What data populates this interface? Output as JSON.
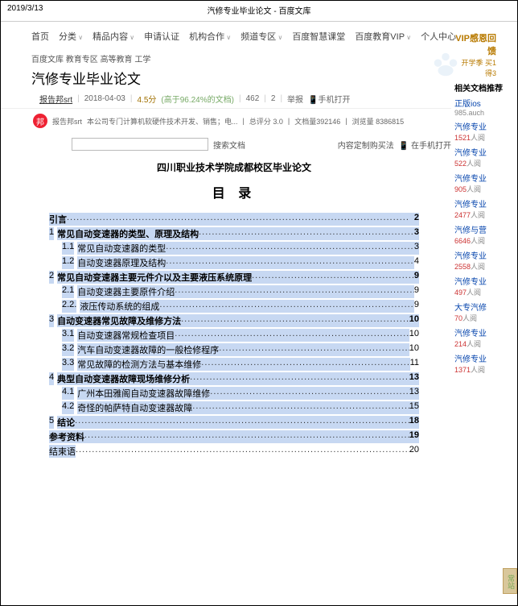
{
  "topbar": {
    "date": "2019/3/13",
    "title": "汽修专业毕业论文 - 百度文库"
  },
  "nav": {
    "home": "首页",
    "cat": "分类",
    "quality": "精品内容",
    "apply": "申请认证",
    "coop": "机构合作",
    "channel": "频道专区",
    "wisdom": "百度智慧课堂",
    "eduvip": "百度教育VIP",
    "personal": "个人中心"
  },
  "breadcrumb": [
    "百度文库",
    "教育专区",
    "高等教育",
    "工学"
  ],
  "page_title": "汽修专业毕业论文",
  "meta": {
    "author": "报告邦srt",
    "date": "2018-04-03",
    "score": "4.5分",
    "rate": "(高于96.24%的文档)",
    "views": "462",
    "pages": "2",
    "jubao": "举报",
    "badge": "📱手机打开"
  },
  "avatar": {
    "glyph": "邦",
    "name": "报告邦srt",
    "desc": "本公司专门计算机软硬件技术开发、销售；电...",
    "sepp": "|",
    "score_lbl": "总评分 3.0",
    "sepp2": "|",
    "docs": "文档量392146",
    "sepp3": "|",
    "views": "浏览量 8386815"
  },
  "search": {
    "placeholder": "",
    "btn": "搜索文档",
    "custom": "内容定制购买法",
    "mobile": "📱 在手机打开"
  },
  "doc": {
    "header": "四川职业技术学院成都校区毕业论文",
    "toc_title": "目  录"
  },
  "toc": [
    {
      "ind": 1,
      "num": "",
      "lbl": "引言",
      "dots_hl": true,
      "pg": "2",
      "pg_hl": true,
      "bold": true
    },
    {
      "ind": 1,
      "num": "1",
      "lbl": "常见自动变速器的类型、原理及结构",
      "dots_hl": true,
      "pg": "3",
      "pg_hl": true,
      "bold": true
    },
    {
      "ind": 2,
      "num": "1.1",
      "lbl": "常见自动变速器的类型",
      "dots_hl": true,
      "pg": "3",
      "pg_hl": true,
      "bold": false
    },
    {
      "ind": 2,
      "num": "1.2",
      "lbl": "自动变速器原理及结构",
      "dots_hl": true,
      "pg": "4",
      "pg_hl": false,
      "bold": false
    },
    {
      "ind": 1,
      "num": "2",
      "lbl": "常见自动变速器主要元件介以及主要液压系统原理",
      "dots_hl": true,
      "pg": "9",
      "pg_hl": true,
      "bold": true
    },
    {
      "ind": 2,
      "num": "2.1",
      "lbl": "自动变速器主要原件介绍",
      "dots_hl": true,
      "pg": "9",
      "pg_hl": false,
      "bold": false
    },
    {
      "ind": 2,
      "num": "2.2.",
      "lbl": "液压传动系统的组成",
      "dots_hl": true,
      "pg": "9",
      "pg_hl": false,
      "bold": false
    },
    {
      "ind": 1,
      "num": "3",
      "lbl": "自动变速器常见故障及维修方法",
      "dots_hl": true,
      "pg": "10",
      "pg_hl": true,
      "bold": true
    },
    {
      "ind": 2,
      "num": "3.1",
      "lbl": "自动变速器常规检查项目",
      "dots_hl": true,
      "pg": "10",
      "pg_hl": false,
      "bold": false
    },
    {
      "ind": 2,
      "num": "3.2",
      "lbl": "汽车自动变速器故障的一般检修程序",
      "dots_hl": true,
      "pg": "10",
      "pg_hl": false,
      "bold": false
    },
    {
      "ind": 2,
      "num": "3.3",
      "lbl": "常见故障的检测方法与基本维修",
      "dots_hl": true,
      "pg": "11",
      "pg_hl": false,
      "bold": false
    },
    {
      "ind": 1,
      "num": "4",
      "lbl": "典型自动变速器故障现场维修分析",
      "dots_hl": true,
      "pg": "13",
      "pg_hl": true,
      "bold": true
    },
    {
      "ind": 2,
      "num": "4.1",
      "lbl": "广州本田雅阁自动变速器故障维修",
      "dots_hl": true,
      "pg": "13",
      "pg_hl": true,
      "bold": false
    },
    {
      "ind": 2,
      "num": "4.2",
      "lbl": "奇怪的帕萨特自动变速器故障",
      "dots_hl": true,
      "pg": "15",
      "pg_hl": true,
      "bold": false
    },
    {
      "ind": 1,
      "num": "5",
      "lbl": "结论",
      "dots_hl": true,
      "pg": "18",
      "pg_hl": true,
      "bold": true
    },
    {
      "ind": 1,
      "num": "",
      "lbl": "参考资料",
      "dots_hl": true,
      "pg": "19",
      "pg_hl": true,
      "bold": true
    },
    {
      "ind": 1,
      "num": "",
      "lbl": "结束语",
      "dots_hl": false,
      "pg": "20",
      "pg_hl": false,
      "bold": false
    }
  ],
  "vip": {
    "line1": "VIP感恩回馈",
    "line2": "开学季 买1得3"
  },
  "sidebar": {
    "header": "相关文档推荐",
    "items": [
      {
        "t": "正版ios",
        "m": "985.auch",
        "n": ""
      },
      {
        "t": "汽修专业",
        "m": "人阅",
        "n": "1521"
      },
      {
        "t": "汽修专业",
        "m": "人阅",
        "n": "522"
      },
      {
        "t": "汽修专业",
        "m": "人阅",
        "n": "905"
      },
      {
        "t": "汽修专业",
        "m": "人阅",
        "n": "2477"
      },
      {
        "t": "汽修与营",
        "m": "人阅",
        "n": "6646"
      },
      {
        "t": "汽修专业",
        "m": "人阅",
        "n": "2558"
      },
      {
        "t": "汽修专业",
        "m": "人阅",
        "n": "497"
      },
      {
        "t": "大专汽修",
        "m": "人阅",
        "n": "70"
      },
      {
        "t": "汽修专业",
        "m": "人阅",
        "n": "214"
      },
      {
        "t": "汽修专业",
        "m": "人阅",
        "n": "1371"
      }
    ]
  },
  "corner": "常站"
}
